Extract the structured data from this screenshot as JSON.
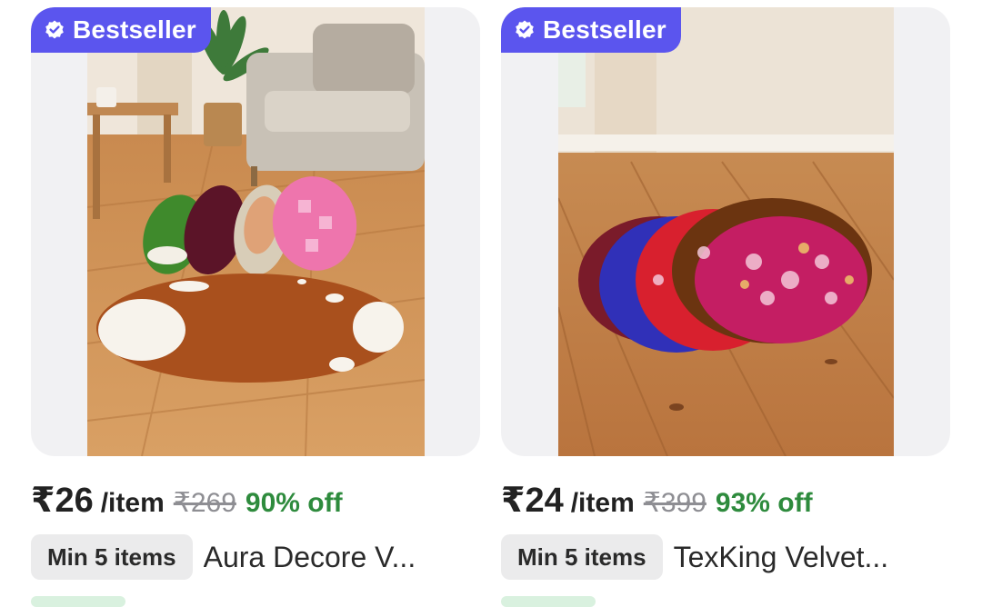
{
  "products": [
    {
      "badge": "Bestseller",
      "price": "₹26",
      "unit": "/item",
      "mrp": "₹269",
      "discount": "90% off",
      "min_order": "Min 5 items",
      "title": "Aura Decore V...",
      "image_icon": "round-rug-photo"
    },
    {
      "badge": "Bestseller",
      "price": "₹24",
      "unit": "/item",
      "mrp": "₹399",
      "discount": "93% off",
      "min_order": "Min 5 items",
      "title": "TexKing Velvet...",
      "image_icon": "floral-velvet-mats-photo"
    }
  ],
  "colors": {
    "badge": "#5b55ee",
    "discount": "#2e8b3d",
    "mrp": "#8e8e93",
    "pill_bg": "#ebebec",
    "image_bg": "#f1f1f3"
  }
}
